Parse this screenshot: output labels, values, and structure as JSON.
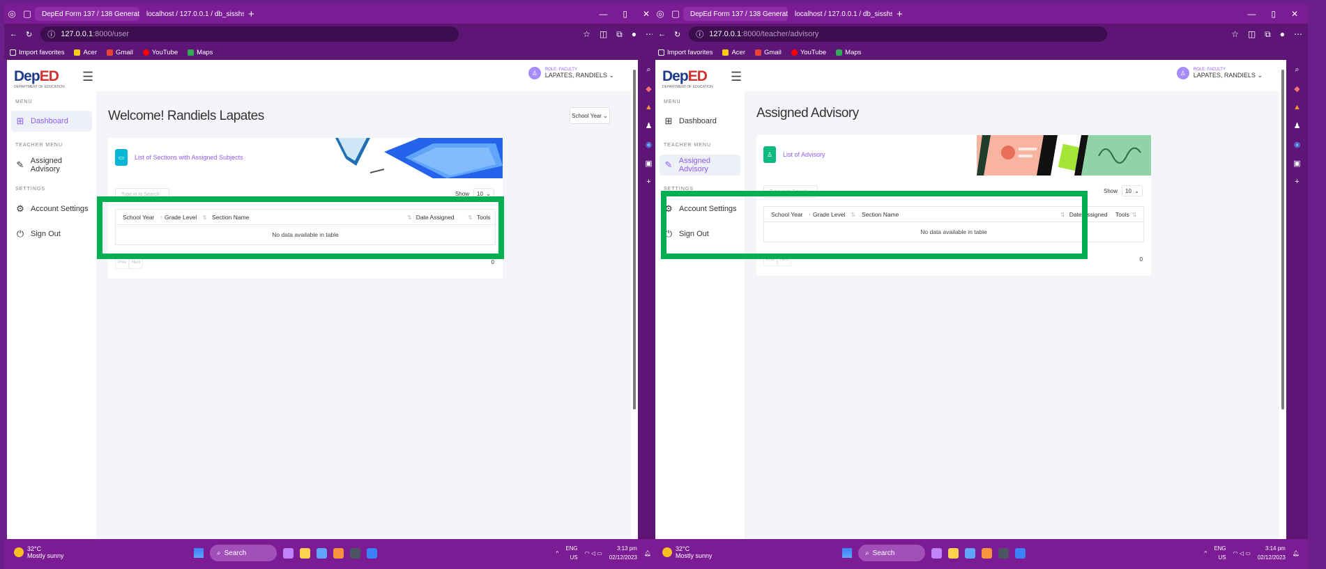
{
  "browser": {
    "tabs": [
      {
        "label": "DepEd Form 137 / 138 Generato"
      },
      {
        "label": "localhost / 127.0.0.1 / db_sisshs"
      }
    ],
    "new_tab": "+",
    "bookmarks": [
      "Import favorites",
      "Acer",
      "Gmail",
      "YouTube",
      "Maps"
    ]
  },
  "sidebar": {
    "menu_title": "MENU",
    "dashboard": "Dashboard",
    "teacher_menu_title": "TEACHER MENU",
    "assigned_advisory": "Assigned Advisory",
    "settings_title": "SETTINGS",
    "account_settings": "Account Settings",
    "sign_out": "Sign Out"
  },
  "user": {
    "role": "ROLE: FACULTY",
    "name": "LAPATES, RANDIELS"
  },
  "left": {
    "url_host": "127.0.0.1",
    "url_path": ":8000/user",
    "page_title": "Welcome! Randiels Lapates",
    "school_year_button": "School Year",
    "card_title": "List of Sections with Assigned Subjects",
    "columns": [
      "School Year",
      "Grade Level",
      "Section Name",
      "Date Assigned",
      "Tools"
    ],
    "empty_text": "No data available in table",
    "search_placeholder": "Type in to Search",
    "show_label": "Show",
    "show_value": "10",
    "prev": "Prev",
    "next": "Next",
    "total": "0"
  },
  "right": {
    "url_host": "127.0.0.1",
    "url_path": ":8000/teacher/advisory",
    "page_title": "Assigned Advisory",
    "card_title": "List of Advisory",
    "columns": [
      "School Year",
      "Grade Level",
      "Section Name",
      "Date Assigned",
      "Tools"
    ],
    "empty_text": "No data available in table",
    "search_placeholder": "Type in to Search",
    "show_label": "Show",
    "show_value": "10",
    "prev": "Prev",
    "next": "Next",
    "total": "0"
  },
  "taskbar": {
    "temp": "32°C",
    "weather": "Mostly sunny",
    "search": "Search",
    "lang": "ENG",
    "region": "US",
    "left_time": "3:13 pm",
    "right_time": "3:14 pm",
    "date": "02/12/2023"
  },
  "colors": {
    "accent": "#8b5cf6",
    "highlight": "#00b050",
    "browser": "#7b1c95"
  }
}
